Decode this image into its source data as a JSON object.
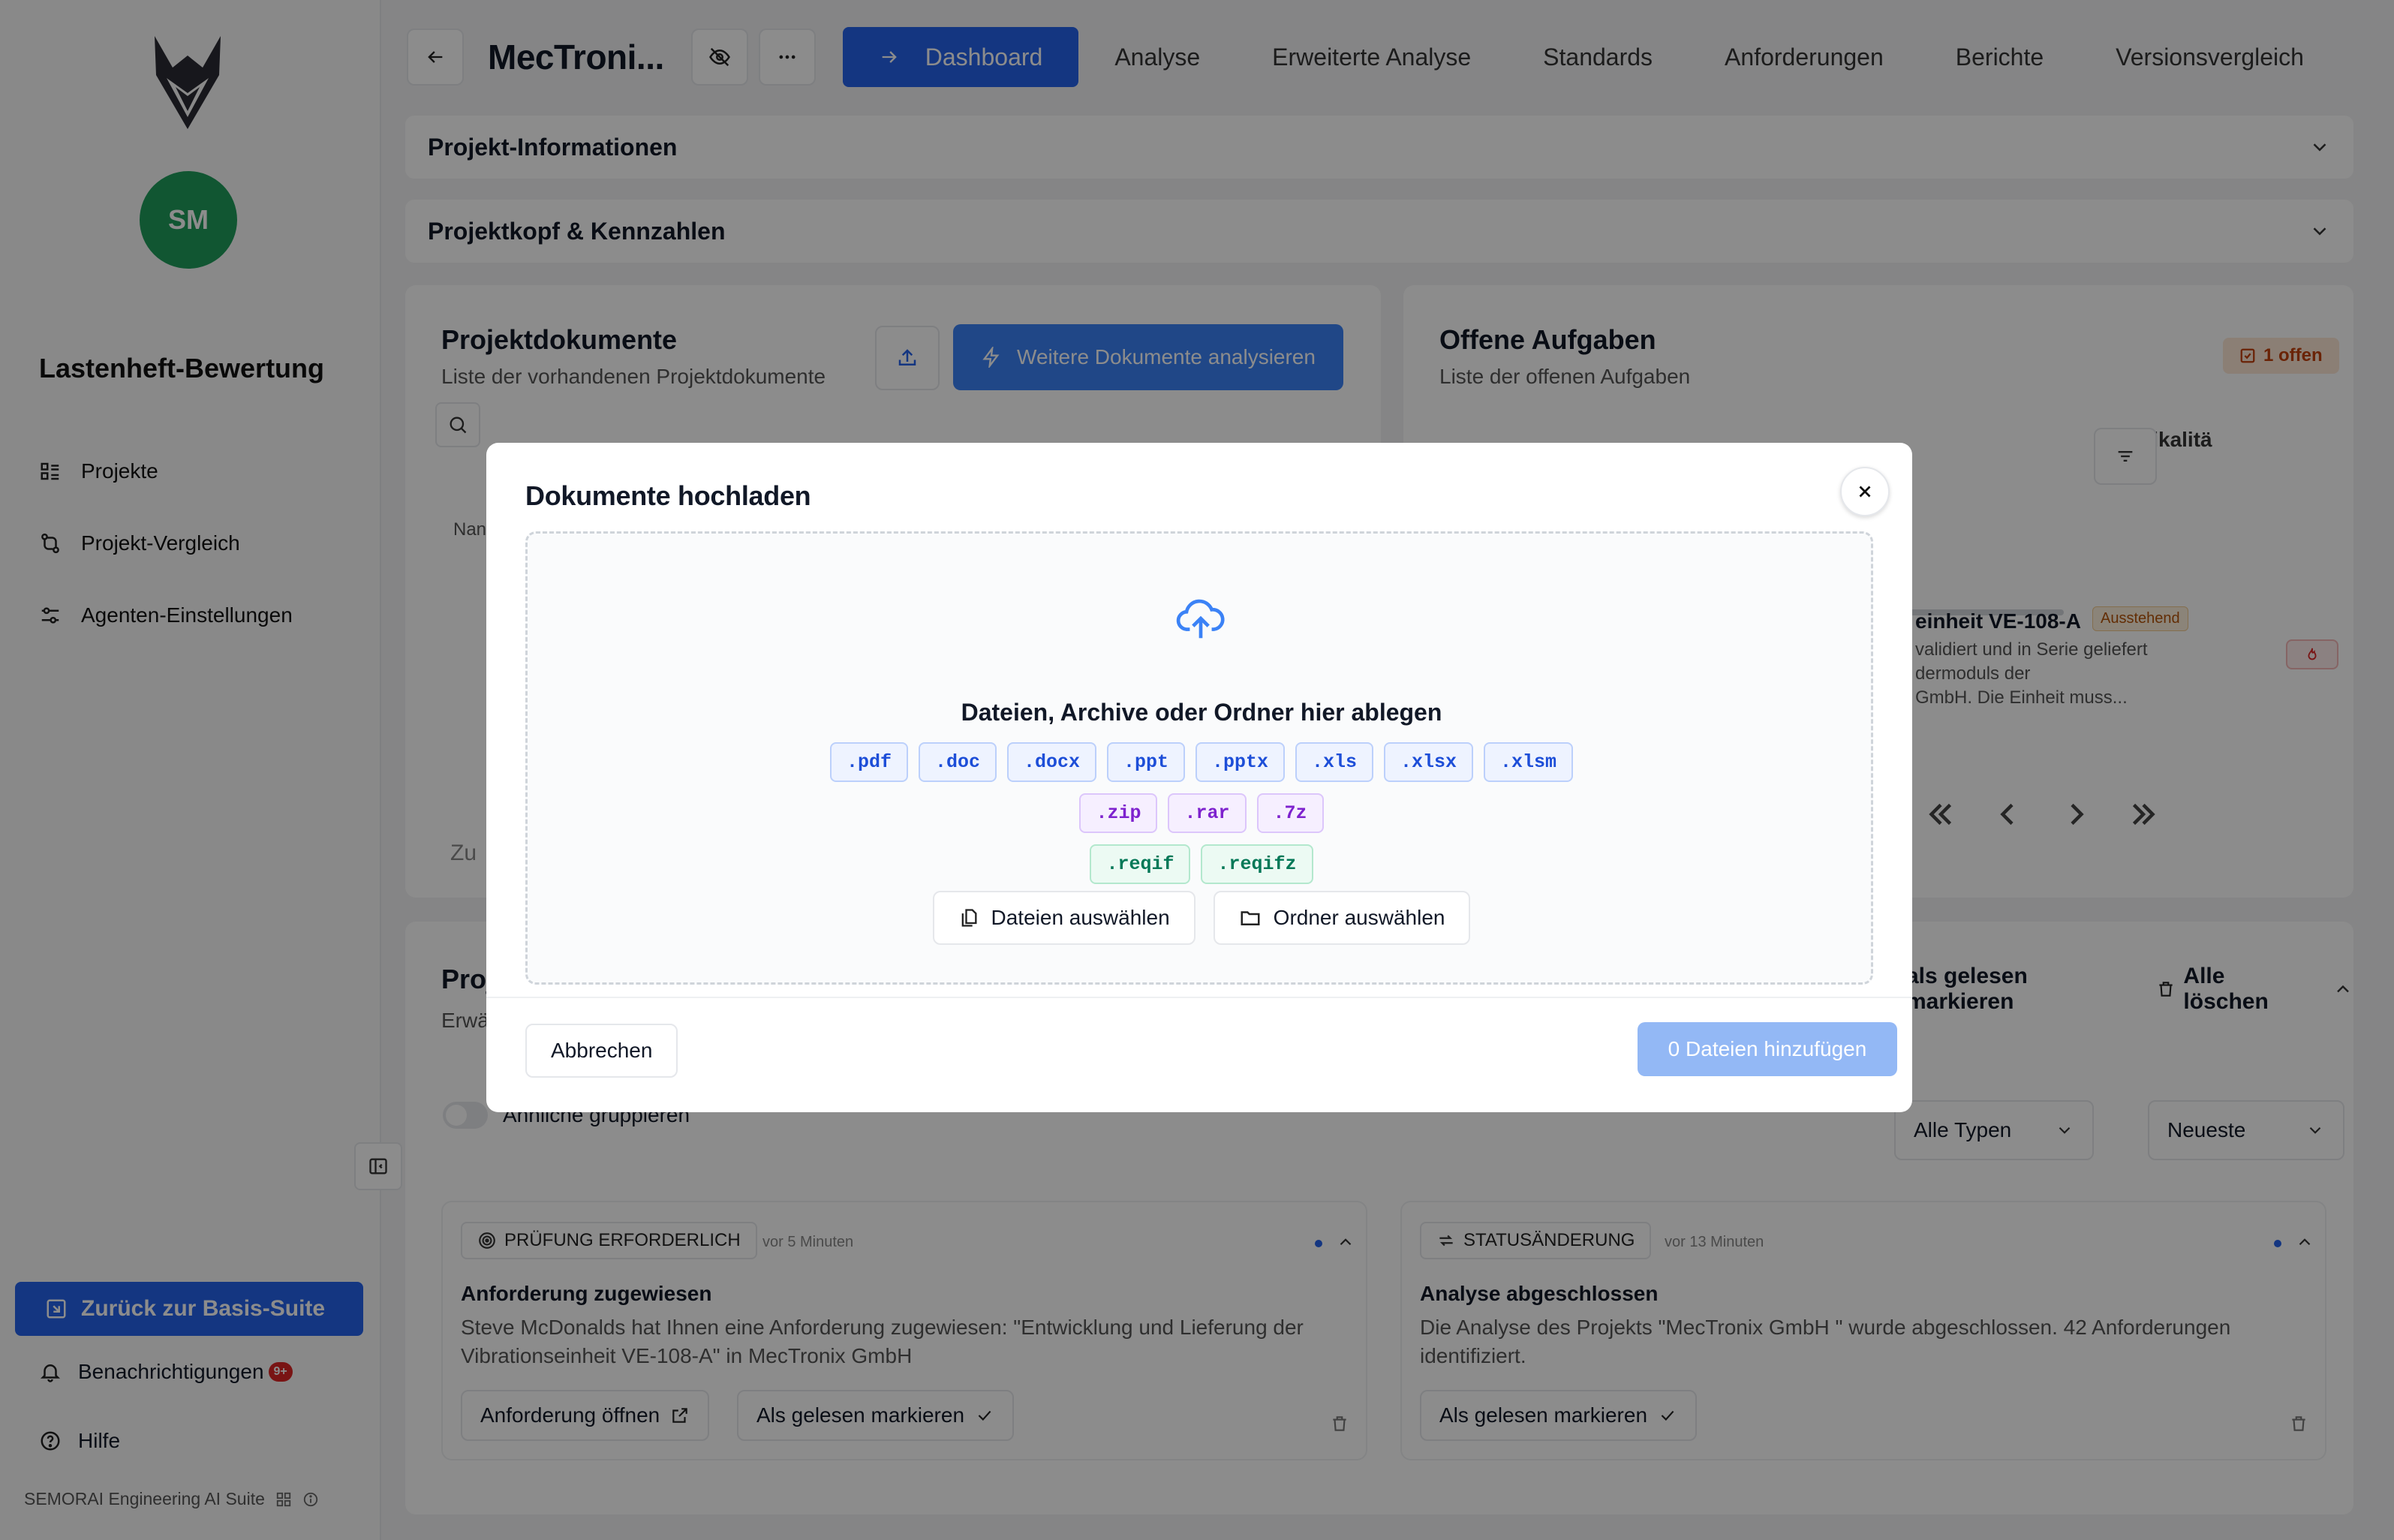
{
  "sidebar": {
    "avatar_initials": "SM",
    "app_title": "Lastenheft-Bewertung",
    "nav": [
      {
        "label": "Projekte",
        "icon": "list-icon"
      },
      {
        "label": "Projekt-Vergleich",
        "icon": "compare-icon"
      },
      {
        "label": "Agenten-Einstellungen",
        "icon": "sliders-icon"
      }
    ],
    "back_to_suite": "Zurück zur Basis-Suite",
    "notifications": "Benachrichtigungen",
    "notifications_badge": "9+",
    "help": "Hilfe",
    "footer": "SEMORAI Engineering AI Suite"
  },
  "header": {
    "project_title": "MecTroni...",
    "tabs": [
      "Dashboard",
      "Analyse",
      "Erweiterte Analyse",
      "Standards",
      "Anforderungen",
      "Berichte",
      "Versionsvergleich"
    ],
    "active_tab": "Dashboard"
  },
  "sections": {
    "project_info": "Projekt-Informationen",
    "project_head": "Projektkopf & Kennzahlen"
  },
  "documents_card": {
    "title": "Projektdokumente",
    "subtitle": "Liste der vorhandenen Projektdokumente",
    "analyze_button": "Weitere Dokumente analysieren",
    "column_fragment": "Nan",
    "footer_fragment": "Zu"
  },
  "tasks_card": {
    "title": "Offene Aufgaben",
    "subtitle": "Liste der offenen Aufgaben",
    "open_badge": "1 offen",
    "column_criticality": "Kritikalitä",
    "task_title_fragment": "einheit VE-108-A",
    "task_status": "Ausstehend",
    "task_desc_lines": [
      "validiert und in Serie geliefert",
      "dermoduls der",
      "GmbH. Die Einheit muss..."
    ]
  },
  "activity": {
    "title_fragment": "Proj",
    "subtitle_fragment": "Erwä",
    "mark_all_read_fragment": "als gelesen markieren",
    "delete_all": "Alle löschen",
    "group_similar": "Ähnliche gruppieren",
    "type_filter": "Alle Typen",
    "sort": "Neueste",
    "items": [
      {
        "chip": "PRÜFUNG ERFORDERLICH",
        "time": "vor 5 Minuten",
        "title": "Anforderung zugewiesen",
        "body": "Steve McDonalds hat Ihnen eine Anforderung zugewiesen: \"Entwicklung und Lieferung der Vibrationseinheit VE-108-A\" in MecTronix GmbH",
        "open_button": "Anforderung öffnen",
        "read_button": "Als gelesen markieren"
      },
      {
        "chip": "STATUSÄNDERUNG",
        "time": "vor 13 Minuten",
        "title": "Analyse abgeschlossen",
        "body": "Die Analyse des Projekts \"MecTronix GmbH \" wurde abgeschlossen. 42 Anforderungen identifiziert.",
        "read_button": "Als gelesen markieren"
      }
    ]
  },
  "modal": {
    "title": "Dokumente hochladen",
    "drop_text": "Dateien, Archive oder Ordner hier ablegen",
    "ext_documents": [
      ".pdf",
      ".doc",
      ".docx",
      ".ppt",
      ".pptx",
      ".xls",
      ".xlsx",
      ".xlsm"
    ],
    "ext_archives": [
      ".zip",
      ".rar",
      ".7z"
    ],
    "ext_reqif": [
      ".reqif",
      ".reqifz"
    ],
    "select_files": "Dateien auswählen",
    "select_folder": "Ordner auswählen",
    "cancel": "Abbrechen",
    "add_files": "0 Dateien hinzufügen"
  },
  "colors": {
    "accent": "#2563eb",
    "avatar": "#1f9d5c",
    "warning": "#c2410c"
  }
}
